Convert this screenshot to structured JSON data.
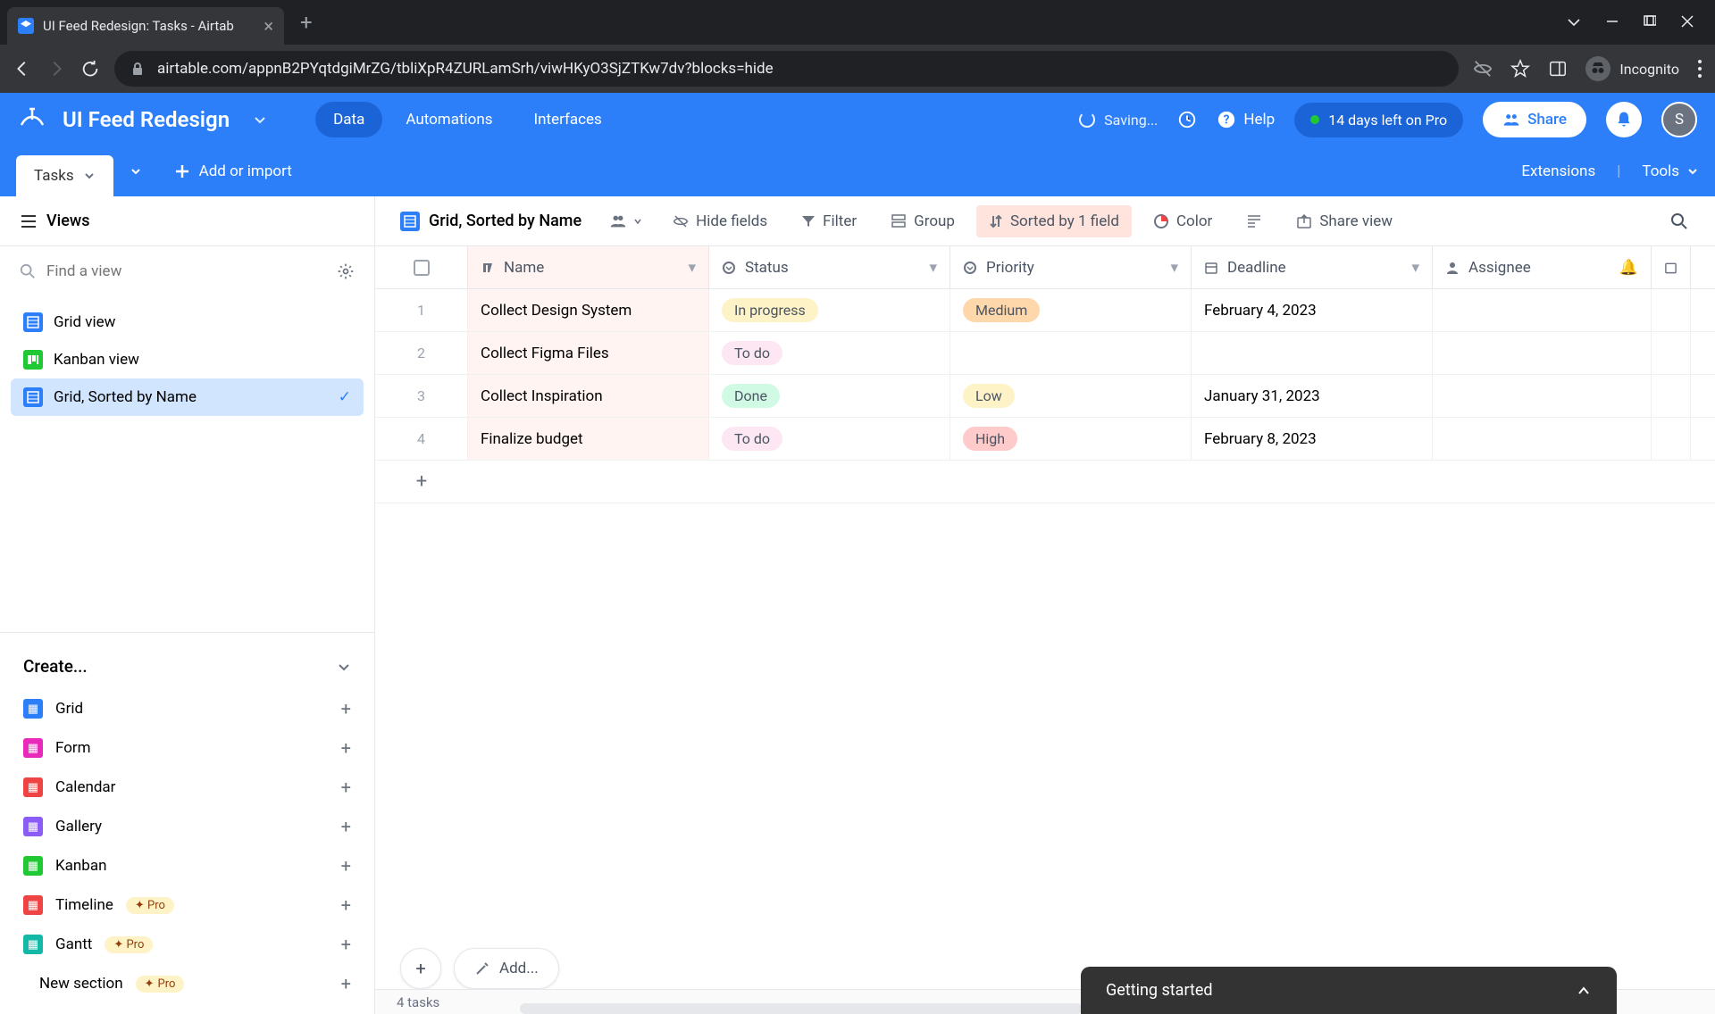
{
  "browser": {
    "tab_title": "UI Feed Redesign: Tasks - Airtab",
    "url": "airtable.com/appnB2PYqtdgiMrZG/tbliXpR4ZURLamSrh/viwHKyO3SjZTKw7dv?blocks=hide",
    "incognito": "Incognito"
  },
  "header": {
    "title": "UI Feed Redesign",
    "tabs": [
      "Data",
      "Automations",
      "Interfaces"
    ],
    "saving": "Saving...",
    "help": "Help",
    "trial": "14 days left on Pro",
    "share": "Share",
    "avatar": "S"
  },
  "table_bar": {
    "active_table": "Tasks",
    "add": "Add or import",
    "extensions": "Extensions",
    "tools": "Tools"
  },
  "sidebar": {
    "views_label": "Views",
    "find_placeholder": "Find a view",
    "views": [
      {
        "label": "Grid view",
        "type": "grid"
      },
      {
        "label": "Kanban view",
        "type": "kanban"
      },
      {
        "label": "Grid, Sorted by Name",
        "type": "grid",
        "active": true
      }
    ],
    "create_label": "Create...",
    "create_items": [
      {
        "label": "Grid",
        "color": "#2d7ff9"
      },
      {
        "label": "Form",
        "color": "#e929ba"
      },
      {
        "label": "Calendar",
        "color": "#ef4444"
      },
      {
        "label": "Gallery",
        "color": "#8b5cf6"
      },
      {
        "label": "Kanban",
        "color": "#20c933"
      },
      {
        "label": "Timeline",
        "color": "#ef4444",
        "pro": true
      },
      {
        "label": "Gantt",
        "color": "#14b8a6",
        "pro": true
      }
    ],
    "new_section": "New section",
    "pro_label": "Pro"
  },
  "toolbar": {
    "view_name": "Grid, Sorted by Name",
    "hide_fields": "Hide fields",
    "filter": "Filter",
    "group": "Group",
    "sorted": "Sorted by 1 field",
    "color": "Color",
    "share_view": "Share view"
  },
  "grid": {
    "columns": [
      "Name",
      "Status",
      "Priority",
      "Deadline",
      "Assignee"
    ],
    "rows": [
      {
        "name": "Collect Design System",
        "status": "In progress",
        "status_cls": "b-inprogress",
        "priority": "Medium",
        "priority_cls": "b-medium",
        "deadline": "February 4, 2023"
      },
      {
        "name": "Collect Figma Files",
        "status": "To do",
        "status_cls": "b-todo",
        "priority": "",
        "priority_cls": "",
        "deadline": ""
      },
      {
        "name": "Collect Inspiration",
        "status": "Done",
        "status_cls": "b-done",
        "priority": "Low",
        "priority_cls": "b-low",
        "deadline": "January 31, 2023"
      },
      {
        "name": "Finalize budget",
        "status": "To do",
        "status_cls": "b-todo",
        "priority": "High",
        "priority_cls": "b-high",
        "deadline": "February 8, 2023"
      }
    ],
    "add_label": "Add...",
    "count": "4 tasks"
  },
  "getting_started": "Getting started"
}
